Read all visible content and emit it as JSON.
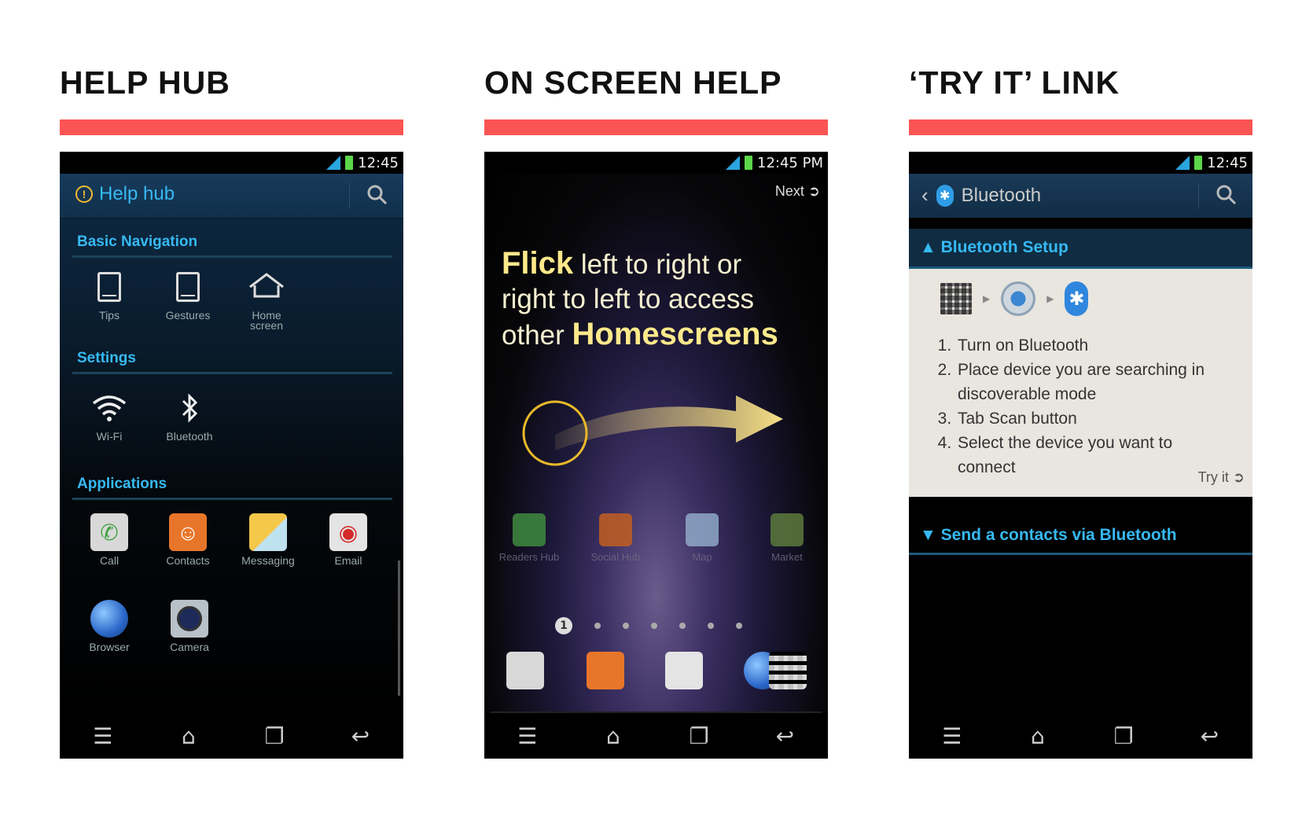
{
  "columns": [
    {
      "title": "HELP HUB"
    },
    {
      "title": "ON SCREEN HELP"
    },
    {
      "title": "‘TRY IT’ LINK"
    }
  ],
  "status": {
    "time_short": "12:45",
    "time_full": "12:45 PM"
  },
  "accent_colors": {
    "header_bar": "#fb5454",
    "section_text": "#36b9f2"
  },
  "help_hub": {
    "title": "Help hub",
    "sections": {
      "basic_navigation": "Basic Navigation",
      "settings": "Settings",
      "applications": "Applications"
    },
    "nav_items": [
      "Tips",
      "Gestures",
      "Home screen"
    ],
    "settings_items": [
      "Wi-Fi",
      "Bluetooth"
    ],
    "apps": [
      "Call",
      "Contacts",
      "Messaging",
      "Email",
      "Browser",
      "Camera"
    ]
  },
  "on_screen_help": {
    "next_label": "Next",
    "flick_word": "Flick",
    "line1_rest": " left to right or",
    "line2": "right to left to access",
    "line3_pre": "other ",
    "homescreens_word": "Homescreens",
    "home_apps": [
      "Readers Hub",
      "Social Hub",
      "Map",
      "Market"
    ],
    "page_indicator": "1"
  },
  "try_it": {
    "title": "Bluetooth",
    "section_open": "Bluetooth Setup",
    "steps": [
      "Turn on Bluetooth",
      "Place device you are searching in discoverable mode",
      "Tab Scan button",
      "Select the device you want to connect"
    ],
    "try_label": "Try it",
    "section_closed": "Send a contacts via Bluetooth"
  }
}
